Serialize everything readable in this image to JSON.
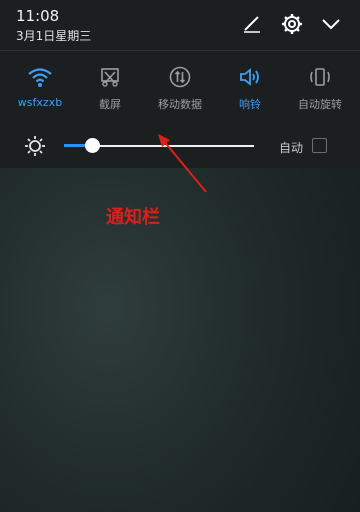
{
  "status": {
    "time": "11:08",
    "date": "3月1日星期三"
  },
  "header_icons": [
    "edit-icon",
    "settings-icon",
    "chevron-down-icon"
  ],
  "quick_tiles": [
    {
      "label": "wsfxzxb",
      "icon": "wifi-icon",
      "active": true
    },
    {
      "label": "截屏",
      "icon": "screenshot-icon",
      "active": false
    },
    {
      "label": "移动数据",
      "icon": "mobile-data-icon",
      "active": false
    },
    {
      "label": "响铃",
      "icon": "ring-icon",
      "active": true
    },
    {
      "label": "自动旋转",
      "icon": "auto-rotate-icon",
      "active": false
    }
  ],
  "brightness": {
    "icon": "brightness-icon",
    "level": 0.15,
    "auto_label": "自动",
    "auto_checked": false
  },
  "annotation": {
    "text": "通知栏",
    "color": "#d9201a"
  },
  "colors": {
    "accent": "#3f9ef6",
    "panel_bg": "#1c1f20"
  }
}
